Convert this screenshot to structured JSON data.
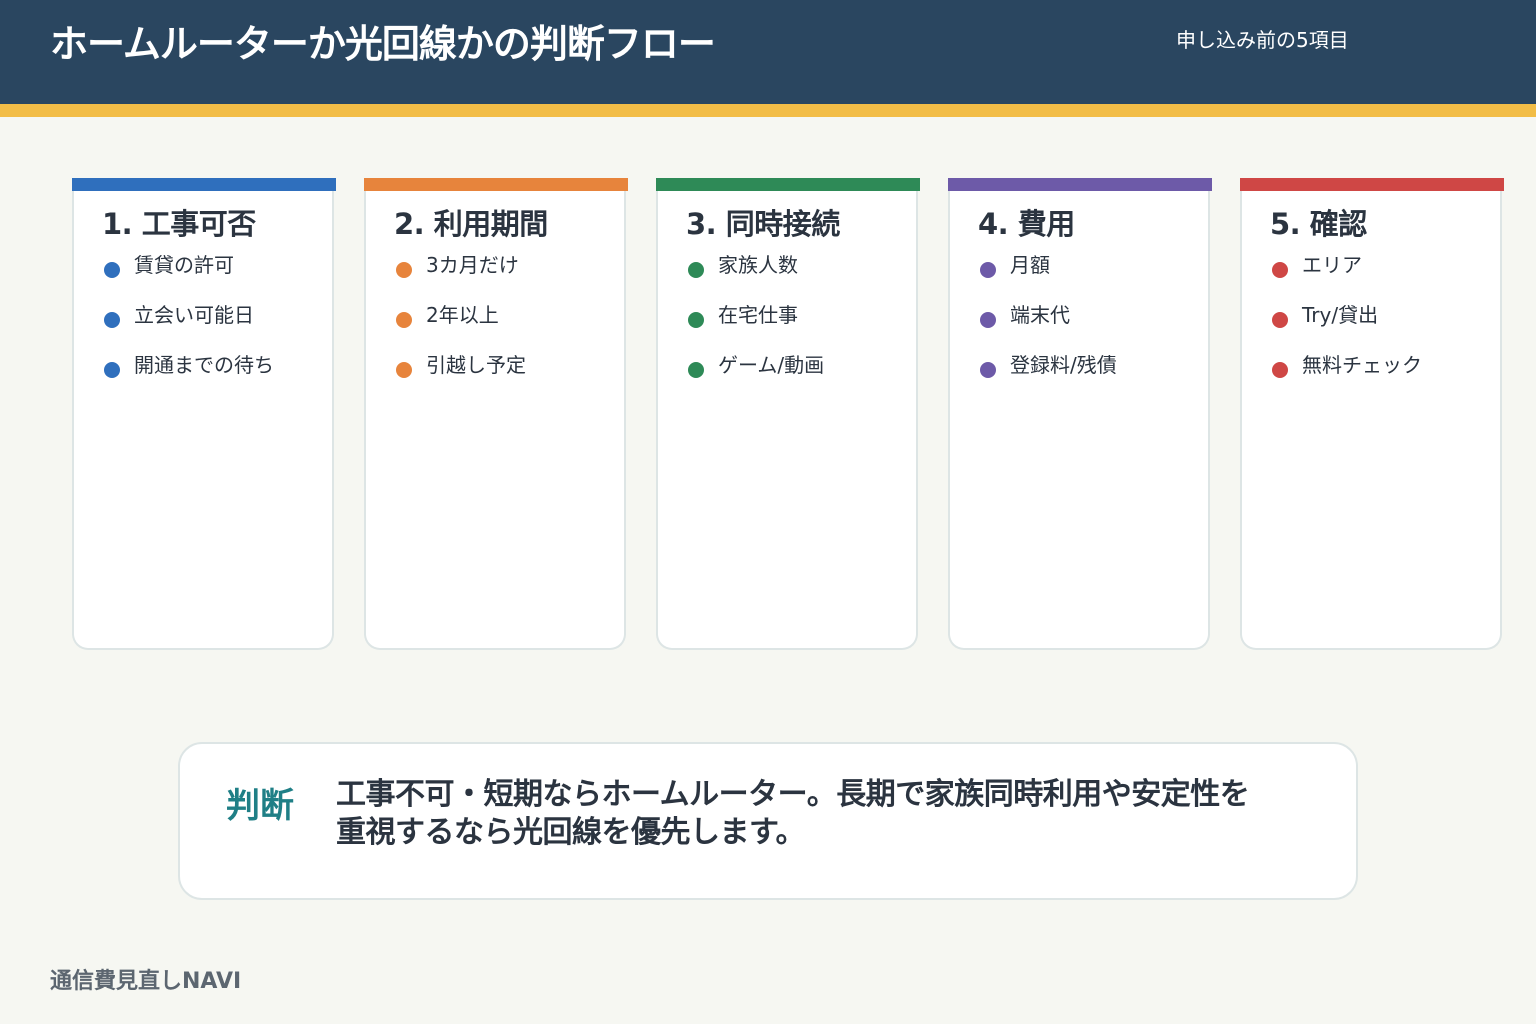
{
  "header": {
    "title": "ホームルーターか光回線かの判断フロー",
    "subtitle": "申し込み前の5項目",
    "background_color": "#2a4660",
    "stripe_color": "#f2bd47"
  },
  "cards": [
    {
      "title": "1. 工事可否",
      "color": "#2f6fbd",
      "items": [
        "賃貸の許可",
        "立会い可能日",
        "開通までの待ち"
      ]
    },
    {
      "title": "2. 利用期間",
      "color": "#e7843c",
      "items": [
        "3カ月だけ",
        "2年以上",
        "引越し予定"
      ]
    },
    {
      "title": "3. 同時接続",
      "color": "#2e8a57",
      "items": [
        "家族人数",
        "在宅仕事",
        "ゲーム/動画"
      ]
    },
    {
      "title": "4. 費用",
      "color": "#6d5aa8",
      "items": [
        "月額",
        "端末代",
        "登録料/残債"
      ]
    },
    {
      "title": "5. 確認",
      "color": "#cf4745",
      "items": [
        "エリア",
        "Try/貸出",
        "無料チェック"
      ]
    }
  ],
  "verdict": {
    "label": "判断",
    "text": "工事不可・短期ならホームルーター。長期で家族同時利用や安定性を重視するなら光回線を優先します。",
    "label_color": "#1f7f86"
  },
  "footer": {
    "brand": "通信費見直しNAVI"
  }
}
